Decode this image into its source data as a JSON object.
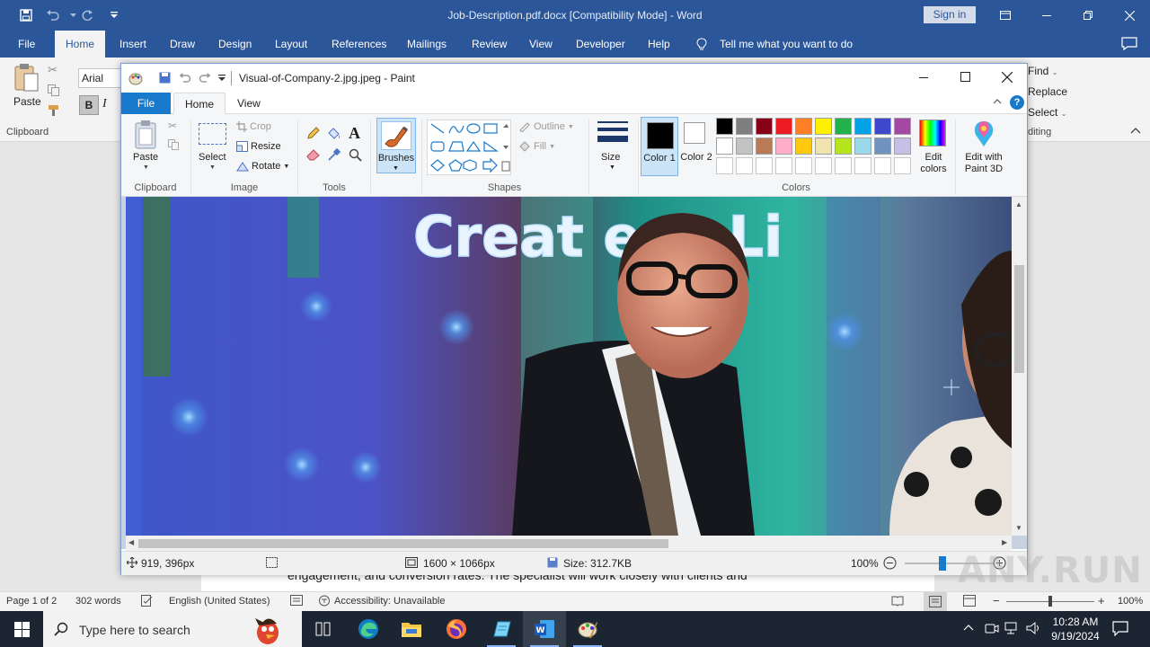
{
  "word": {
    "title": "Job-Description.pdf.docx  [Compatibility Mode]  -  Word",
    "sign_in": "Sign in",
    "tabs": [
      "File",
      "Home",
      "Insert",
      "Draw",
      "Design",
      "Layout",
      "References",
      "Mailings",
      "Review",
      "View",
      "Developer",
      "Help"
    ],
    "tell_me": "Tell me what you want to do",
    "ribbon": {
      "paste": "Paste",
      "clipboard": "Clipboard",
      "font": "Arial",
      "bold": "B",
      "italic": "I",
      "find": "Find",
      "replace": "Replace",
      "select": "Select",
      "editing": "diting"
    },
    "doc_text": "engagement, and conversion rates. The specialist will work closely with clients and",
    "status": {
      "page": "Page 1 of 2",
      "words": "302 words",
      "language": "English (United States)",
      "accessibility": "Accessibility: Unavailable",
      "zoom": "100%"
    }
  },
  "paint": {
    "title": "Visual-of-Company-2.jpg.jpeg - Paint",
    "tabs": {
      "file": "File",
      "home": "Home",
      "view": "View"
    },
    "groups": {
      "clipboard": "Clipboard",
      "image": "Image",
      "tools": "Tools",
      "shapes": "Shapes",
      "colors": "Colors"
    },
    "buttons": {
      "paste": "Paste",
      "select": "Select",
      "crop": "Crop",
      "resize": "Resize",
      "rotate": "Rotate",
      "brushes": "Brushes",
      "outline": "Outline",
      "fill": "Fill",
      "size": "Size",
      "color1": "Color 1",
      "color2": "Color 2",
      "edit_colors": "Edit colors",
      "edit_paint3d": "Edit with Paint 3D"
    },
    "palette_row1": [
      "#000000",
      "#7f7f7f",
      "#880015",
      "#ed1c24",
      "#ff7f27",
      "#fff200",
      "#22b14c",
      "#00a2e8",
      "#3f48cc",
      "#a349a4"
    ],
    "palette_row2": [
      "#ffffff",
      "#c3c3c3",
      "#b97a57",
      "#ffaec9",
      "#ffc90e",
      "#efe4b0",
      "#b5e61d",
      "#99d9ea",
      "#7092be",
      "#c8bfe7"
    ],
    "color1": "#000000",
    "color2": "#ffffff",
    "image_text": "Creat  e  &  Li",
    "status": {
      "cursor": "919, 396px",
      "dimensions": "1600 × 1066px",
      "size": "Size: 312.7KB",
      "zoom": "100%"
    }
  },
  "taskbar": {
    "search_placeholder": "Type here to search",
    "time": "10:28 AM",
    "date": "9/19/2024"
  },
  "watermark": "ANY.RUN"
}
